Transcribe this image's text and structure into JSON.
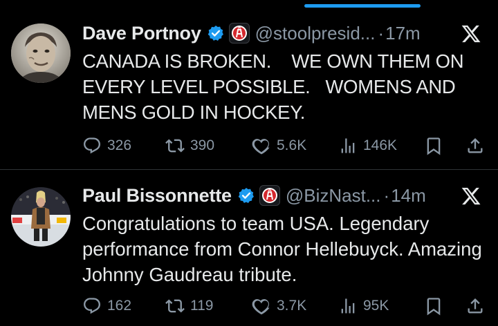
{
  "tweets": [
    {
      "author": "Dave Portnoy",
      "handle": "@stoolpresid...",
      "separator": "·",
      "time": "17m",
      "text": "CANADA IS BROKEN.    WE OWN THEM ON EVERY LEVEL POSSIBLE.   WOMENS AND MENS GOLD IN HOCKEY.",
      "replies": "326",
      "reposts": "390",
      "likes": "5.6K",
      "views": "146K"
    },
    {
      "author": "Paul Bissonnette",
      "handle": "@BizNast...",
      "separator": "·",
      "time": "14m",
      "text": "Congratulations to team USA. Legendary performance from Connor Hellebuyck. Amazing Johnny Gaudreau tribute.",
      "replies": "162",
      "reposts": "119",
      "likes": "3.7K",
      "views": "95K"
    }
  ],
  "colors": {
    "background": "#000000",
    "text": "#e7e9ea",
    "secondary": "#8b98a5",
    "accent": "#1d9bf0",
    "divider": "#2f3336"
  },
  "icons": [
    "verified-badge-icon",
    "affiliate-badge-icon",
    "x-logo-icon",
    "reply-icon",
    "repost-icon",
    "like-icon",
    "views-icon",
    "bookmark-icon",
    "share-icon"
  ]
}
